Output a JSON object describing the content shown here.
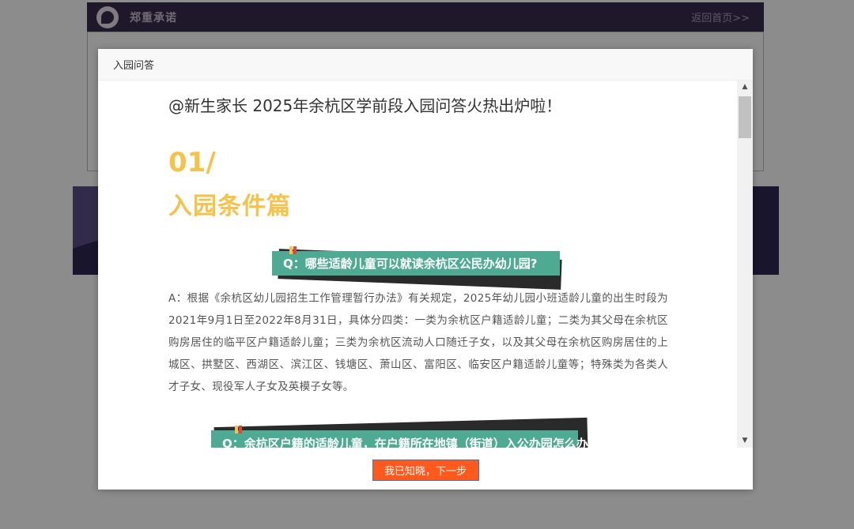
{
  "background": {
    "header_title": "郑重承诺",
    "home_link": "返回首页>>"
  },
  "modal": {
    "title": "入园问答",
    "article": {
      "intro": "@新生家长 2025年余杭区学前段入园问答火热出炉啦！",
      "section_number": "01/",
      "section_title": "入园条件篇",
      "question1": "Q：哪些适龄儿童可以就读余杭区公民办幼儿园?",
      "answer1": "A：根据《余杭区幼儿园招生工作管理暂行办法》有关规定，2025年幼儿园小班适龄儿童的出生时段为2021年9月1日至2022年8月31日，具体分四类：一类为余杭区户籍适龄儿童；二类为其父母在余杭区购房居住的临平区户籍适龄儿童；三类为余杭区流动人口随迁子女，以及其父母在余杭区购房居住的上城区、拱墅区、西湖区、滨江区、钱塘区、萧山区、富阳区、临安区户籍适龄儿童等；特殊类为各类人才子女、现役军人子女及英模子女等。",
      "question2": "Q：余杭区户籍的适龄儿童，在户籍所在地镇（街道）入公办园怎么办?"
    },
    "confirm_button": "我已知晓，下一步"
  },
  "colors": {
    "accent_yellow": "#f5c34b",
    "question_green": "#4eaa92",
    "button_orange": "#ff5a1e",
    "header_purple": "#3a2a4e"
  },
  "icons": {
    "logo": "chat-bubble-logo-icon",
    "scroll_up": "triangle-up-icon",
    "scroll_down": "triangle-down-icon"
  }
}
